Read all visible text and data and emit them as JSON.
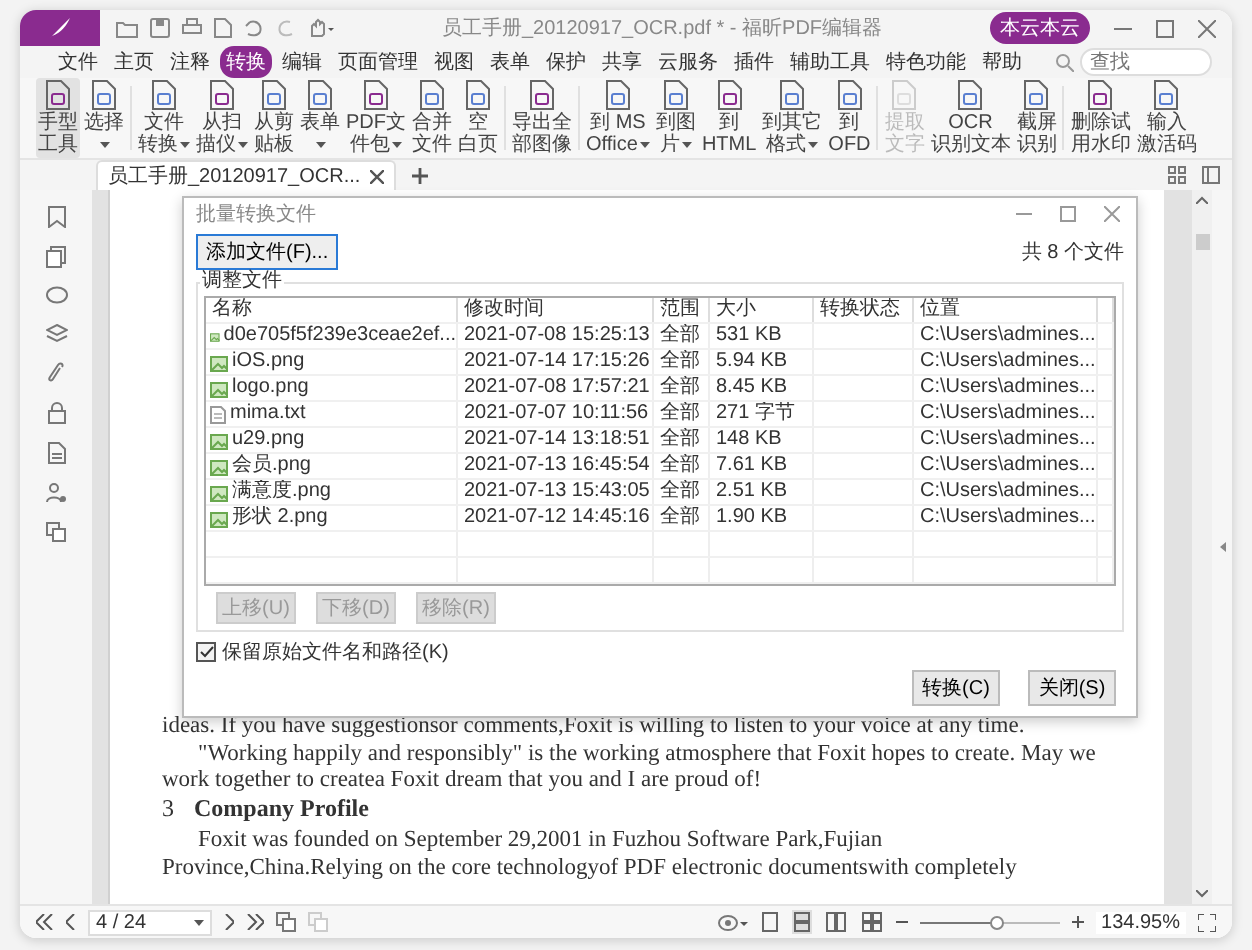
{
  "app": {
    "title": "员工手册_20120917_OCR.pdf * - 福昕PDF编辑器",
    "user": "本云本云"
  },
  "menu": [
    {
      "label": "文件",
      "selected": false
    },
    {
      "label": "主页",
      "selected": false
    },
    {
      "label": "注释",
      "selected": false
    },
    {
      "label": "转换",
      "selected": true
    },
    {
      "label": "编辑",
      "selected": false
    },
    {
      "label": "页面管理",
      "selected": false
    },
    {
      "label": "视图",
      "selected": false
    },
    {
      "label": "表单",
      "selected": false
    },
    {
      "label": "保护",
      "selected": false
    },
    {
      "label": "共享",
      "selected": false
    },
    {
      "label": "云服务",
      "selected": false
    },
    {
      "label": "插件",
      "selected": false
    },
    {
      "label": "辅助工具",
      "selected": false
    },
    {
      "label": "特色功能",
      "selected": false
    },
    {
      "label": "帮助",
      "selected": false
    }
  ],
  "search": {
    "placeholder": "查找"
  },
  "ribbon": [
    {
      "lines": [
        "手型",
        "工具"
      ],
      "selected": true,
      "disabled": false,
      "dropdown": false
    },
    {
      "lines": [
        "选择"
      ],
      "selected": false,
      "disabled": false,
      "dropdown": true
    },
    {
      "lines": [
        "文件",
        "转换"
      ],
      "selected": false,
      "disabled": false,
      "dropdown": true
    },
    {
      "lines": [
        "从扫",
        "描仪"
      ],
      "selected": false,
      "disabled": false,
      "dropdown": true
    },
    {
      "lines": [
        "从剪",
        "贴板"
      ],
      "selected": false,
      "disabled": false,
      "dropdown": false
    },
    {
      "lines": [
        "表单"
      ],
      "selected": false,
      "disabled": false,
      "dropdown": true
    },
    {
      "lines": [
        "PDF文",
        "件包"
      ],
      "selected": false,
      "disabled": false,
      "dropdown": true
    },
    {
      "lines": [
        "合并",
        "文件"
      ],
      "selected": false,
      "disabled": false,
      "dropdown": false
    },
    {
      "lines": [
        "空",
        "白页"
      ],
      "selected": false,
      "disabled": false,
      "dropdown": false
    },
    {
      "lines": [
        "导出全",
        "部图像"
      ],
      "selected": false,
      "disabled": false,
      "dropdown": false
    },
    {
      "lines": [
        "到 MS",
        "Office"
      ],
      "selected": false,
      "disabled": false,
      "dropdown": true
    },
    {
      "lines": [
        "到图",
        "片"
      ],
      "selected": false,
      "disabled": false,
      "dropdown": true
    },
    {
      "lines": [
        "到",
        "HTML"
      ],
      "selected": false,
      "disabled": false,
      "dropdown": false
    },
    {
      "lines": [
        "到其它",
        "格式"
      ],
      "selected": false,
      "disabled": false,
      "dropdown": true
    },
    {
      "lines": [
        "到",
        "OFD"
      ],
      "selected": false,
      "disabled": false,
      "dropdown": false
    },
    {
      "lines": [
        "提取",
        "文字"
      ],
      "selected": false,
      "disabled": true,
      "dropdown": false
    },
    {
      "lines": [
        "OCR",
        "识别文本"
      ],
      "selected": false,
      "disabled": false,
      "dropdown": false
    },
    {
      "lines": [
        "截屏",
        "识别"
      ],
      "selected": false,
      "disabled": false,
      "dropdown": false
    },
    {
      "lines": [
        "删除试",
        "用水印"
      ],
      "selected": false,
      "disabled": false,
      "dropdown": false
    },
    {
      "lines": [
        "输入",
        "激活码"
      ],
      "selected": false,
      "disabled": false,
      "dropdown": false
    }
  ],
  "doc_tab": {
    "label": "员工手册_20120917_OCR..."
  },
  "document": {
    "paragraphs": [
      {
        "kind": "continued",
        "text": "ideas. If you have suggestionsor comments,Foxit is willing to listen to your voice at any time."
      },
      {
        "kind": "indented",
        "text": "\"Working happily and responsibly\" is the working atmosphere that Foxit hopes to create. May we work together to createa Foxit dream that you and I are proud of!"
      },
      {
        "kind": "heading",
        "number": "3",
        "text": "Company Profile"
      },
      {
        "kind": "indented",
        "text": "Foxit  was founded on September 29,2001 in Fuzhou Software Park,Fujian"
      },
      {
        "kind": "continued",
        "text": "Province,China.Relying on  the core  technologyof PDF electronic documentswith completely"
      }
    ]
  },
  "dialog": {
    "title": "批量转换文件",
    "add_button": "添加文件(F)...",
    "count": "共 8 个文件",
    "group_label": "调整文件",
    "columns": [
      "名称",
      "修改时间",
      "范围",
      "大小",
      "转换状态",
      "位置"
    ],
    "rows": [
      {
        "kind": "image",
        "name": "d0e705f5f239e3ceae2ef...",
        "time": "2021-07-08 15:25:13",
        "range": "全部",
        "size": "531 KB",
        "location": "C:\\Users\\admines..."
      },
      {
        "kind": "image",
        "name": "iOS.png",
        "time": "2021-07-14 17:15:26",
        "range": "全部",
        "size": "5.94 KB",
        "location": "C:\\Users\\admines..."
      },
      {
        "kind": "image",
        "name": "logo.png",
        "time": "2021-07-08 17:57:21",
        "range": "全部",
        "size": "8.45 KB",
        "location": "C:\\Users\\admines..."
      },
      {
        "kind": "text",
        "name": "mima.txt",
        "time": "2021-07-07 10:11:56",
        "range": "全部",
        "size": "271 字节",
        "location": "C:\\Users\\admines..."
      },
      {
        "kind": "image",
        "name": "u29.png",
        "time": "2021-07-14 13:18:51",
        "range": "全部",
        "size": "148 KB",
        "location": "C:\\Users\\admines..."
      },
      {
        "kind": "image",
        "name": "会员.png",
        "time": "2021-07-13 16:45:54",
        "range": "全部",
        "size": "7.61 KB",
        "location": "C:\\Users\\admines..."
      },
      {
        "kind": "image",
        "name": "满意度.png",
        "time": "2021-07-13 15:43:05",
        "range": "全部",
        "size": "2.51 KB",
        "location": "C:\\Users\\admines..."
      },
      {
        "kind": "image",
        "name": "形状 2.png",
        "time": "2021-07-12 14:45:16",
        "range": "全部",
        "size": "1.90 KB",
        "location": "C:\\Users\\admines..."
      }
    ],
    "move_buttons": [
      {
        "label": "上移(U)",
        "disabled": true
      },
      {
        "label": "下移(D)",
        "disabled": true
      },
      {
        "label": "移除(R)",
        "disabled": true
      }
    ],
    "keep_path": {
      "label": "保留原始文件名和路径(K)",
      "checked": true
    },
    "actions": [
      "转换(C)",
      "关闭(S)"
    ]
  },
  "status_bar": {
    "page": "4 / 24",
    "zoom": "134.95%",
    "level": 0.55,
    "views": [
      {
        "kind": "single",
        "selected": false
      },
      {
        "kind": "continuous",
        "selected": true
      },
      {
        "kind": "facing",
        "selected": false
      },
      {
        "kind": "facing-continuous",
        "selected": false
      }
    ]
  }
}
